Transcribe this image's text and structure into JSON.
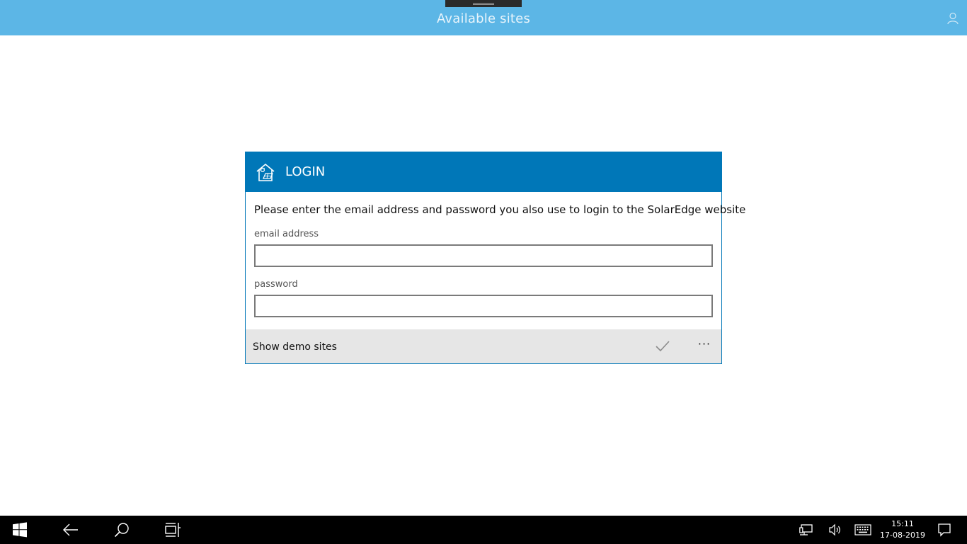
{
  "titlebar": {
    "title": "Available sites"
  },
  "login": {
    "title": "LOGIN",
    "instructions": "Please enter the email address and password you also use to login to the SolarEdge website",
    "email_label": "email address",
    "email_value": "",
    "password_label": "password",
    "password_value": "",
    "demo_label": "Show demo sites",
    "more_label": "···"
  },
  "taskbar": {
    "time": "15:11",
    "date": "17-08-2019",
    "icons": [
      "windows-start-icon",
      "back-arrow-icon",
      "search-icon",
      "task-view-icon",
      "network-icon",
      "volume-icon",
      "touch-keyboard-icon",
      "action-center-icon"
    ]
  },
  "colors": {
    "titlebar": "#5cb6e6",
    "dialog_header": "#0077b8",
    "footer": "#e6e6e6",
    "taskbar": "#000000"
  }
}
